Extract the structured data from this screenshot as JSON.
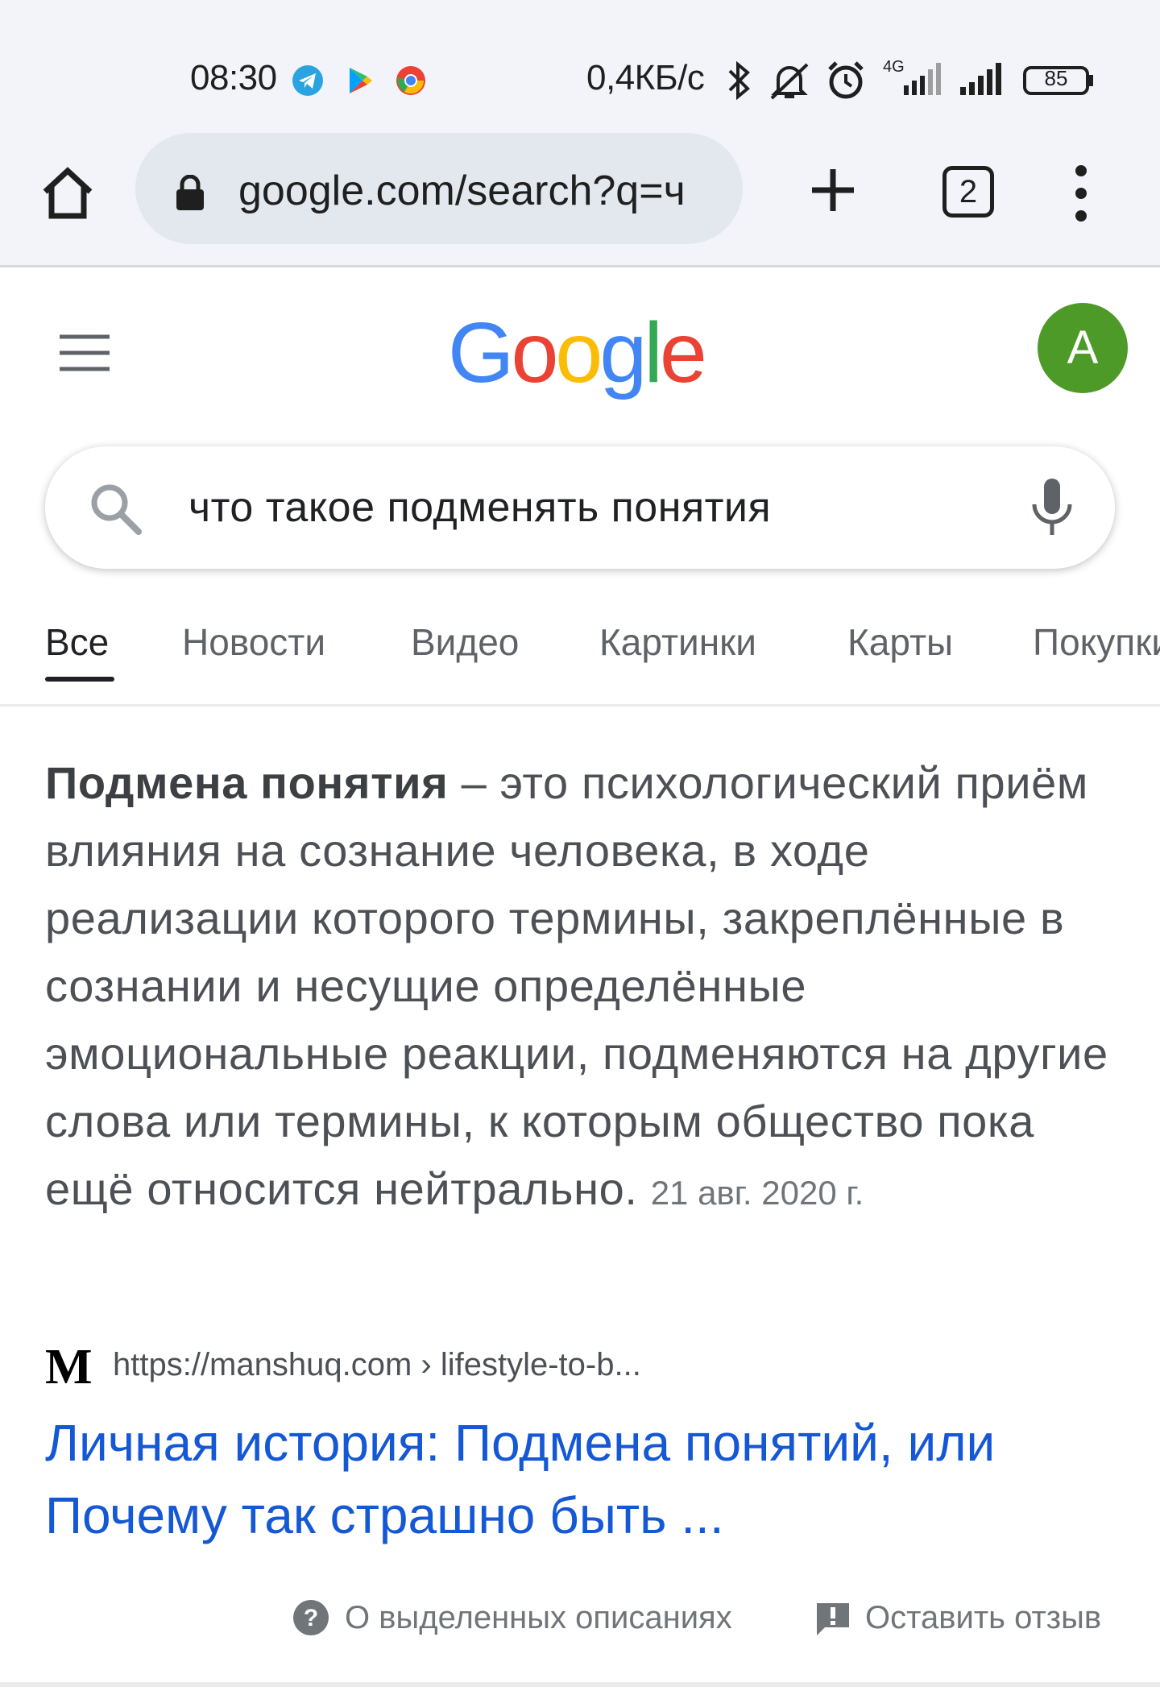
{
  "status_bar": {
    "time": "08:30",
    "speed": "0,4КБ/с",
    "network_type": "4G",
    "battery": "85",
    "app_icons": [
      "telegram-icon",
      "play-store-icon",
      "chrome-icon"
    ],
    "right_icons": [
      "bluetooth-icon",
      "muted-bell-icon",
      "alarm-icon",
      "signal-icon",
      "battery-icon"
    ]
  },
  "browser": {
    "url": "google.com/search?q=ч",
    "tab_count": "2"
  },
  "header": {
    "logo": "Google",
    "avatar_letter": "A",
    "avatar_color": "#4e9a29"
  },
  "search": {
    "query": "что такое подменять понятия"
  },
  "tabs": [
    {
      "label": "Все",
      "active": true
    },
    {
      "label": "Новости"
    },
    {
      "label": "Видео"
    },
    {
      "label": "Картинки"
    },
    {
      "label": "Карты"
    },
    {
      "label": "Покупки"
    }
  ],
  "snippet": {
    "term": "Подмена понятия",
    "text": " – это психологический приём влияния на сознание человека, в ходе реализации которого термины, закреплённые в сознании и несущие определённые эмоциональные реакции, подменяются на другие слова или термины, к которым общество пока ещё относится нейтрально.",
    "date": "21 авг. 2020 г."
  },
  "result": {
    "favicon_letter": "M",
    "url": "https://manshuq.com › lifestyle-to-b...",
    "title": "Личная история: Подмена понятий, или Почему так страшно быть ..."
  },
  "footer": {
    "about_label": "О выделенных описаниях",
    "feedback_label": "Оставить отзыв"
  },
  "colors": {
    "link_blue": "#1558d6",
    "google_blue": "#4285f4",
    "google_red": "#ea4335",
    "google_yellow": "#fbbc05",
    "google_green": "#34a853"
  }
}
